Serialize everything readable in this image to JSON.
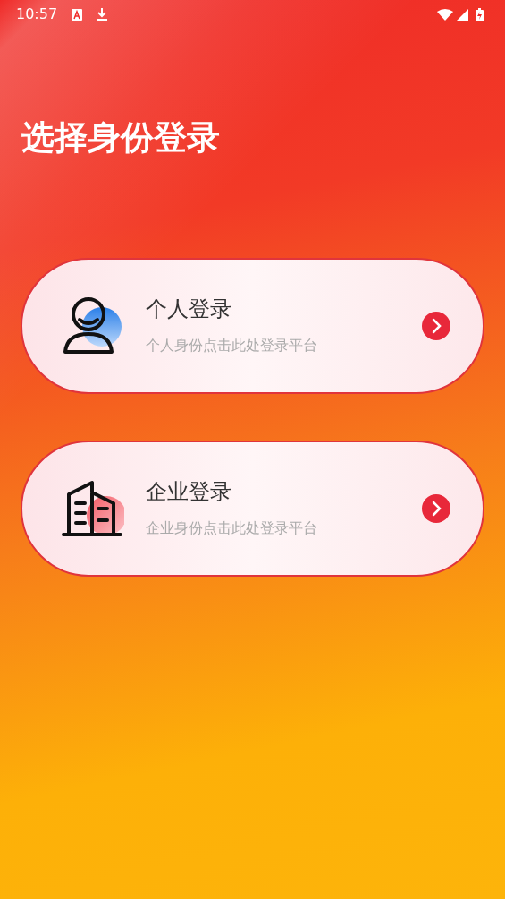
{
  "status_bar": {
    "time": "10:57"
  },
  "title": "选择身份登录",
  "options": [
    {
      "kind": "person",
      "title": "个人登录",
      "subtitle": "个人身份点击此处登录平台"
    },
    {
      "kind": "building",
      "title": "企业登录",
      "subtitle": "企业身份点击此处登录平台"
    }
  ]
}
